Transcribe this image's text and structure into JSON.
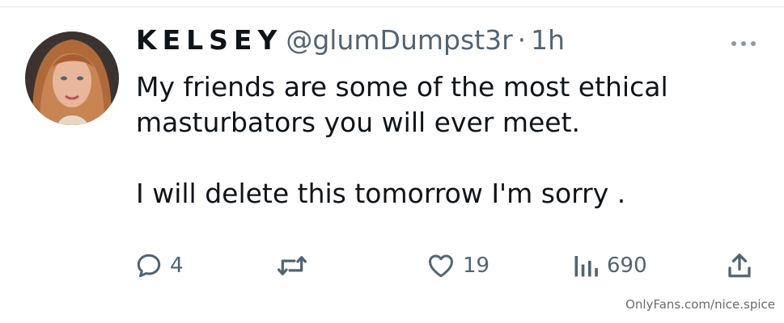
{
  "tweet": {
    "display_name": "KELSEY",
    "handle": "@glumDumpst3r",
    "separator": "·",
    "time": "1h",
    "text_lines": [
      "My friends are some of the most ethical",
      "masturbators you will ever meet.",
      "",
      "I will delete this tomorrow I'm sorry ."
    ]
  },
  "actions": {
    "reply_count": "4",
    "retweet_count": "",
    "like_count": "19",
    "views_count": "690"
  },
  "icons": {
    "more": "more-horizontal-icon",
    "reply": "reply-icon",
    "retweet": "retweet-icon",
    "like": "heart-icon",
    "views": "views-bar-icon",
    "share": "share-icon"
  },
  "colors": {
    "text": "#0f1419",
    "secondary": "#536471"
  },
  "watermark": "OnlyFans.com/nice.spice"
}
